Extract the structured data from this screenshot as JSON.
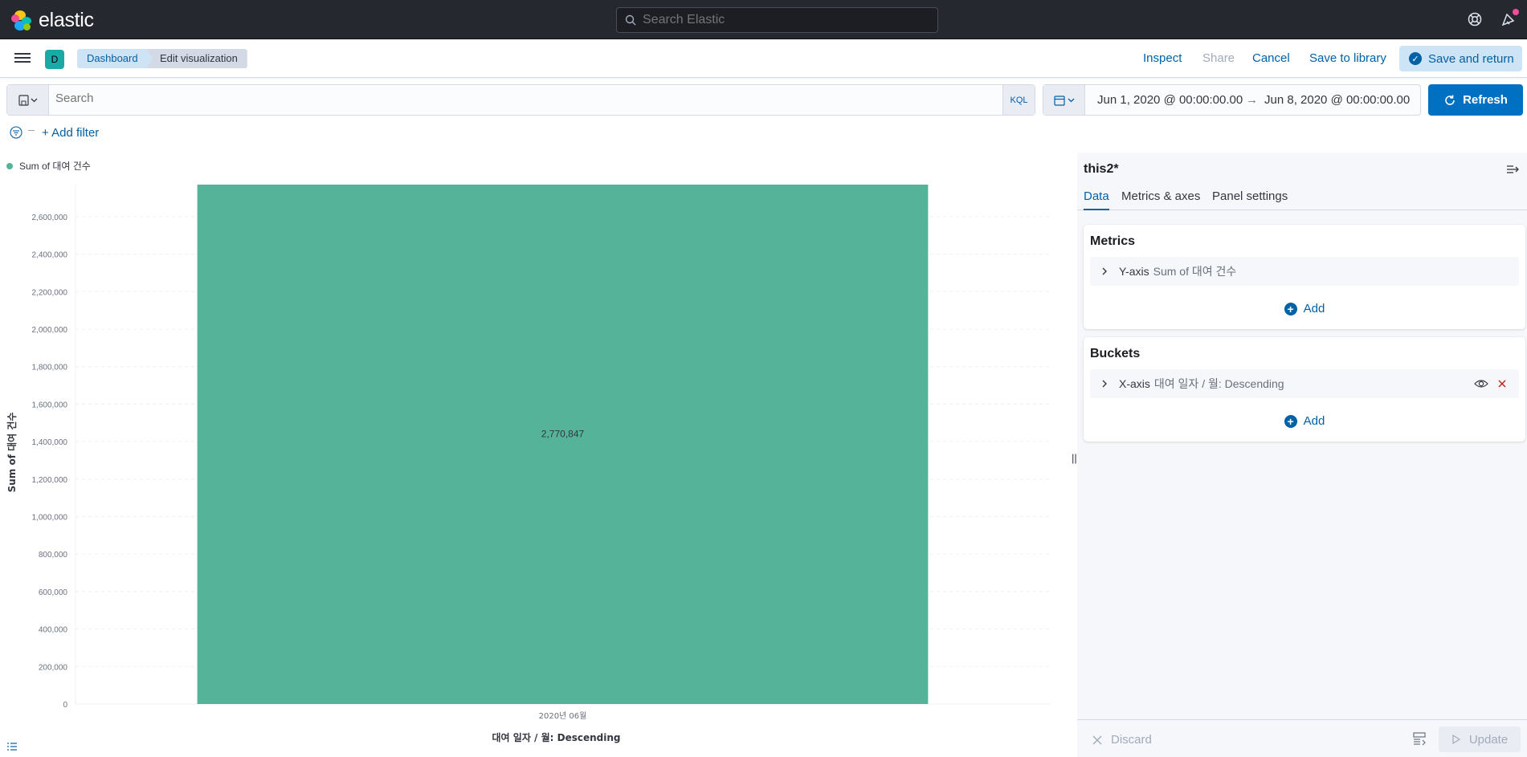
{
  "header": {
    "logo_text": "elastic",
    "search_placeholder": "Search Elastic",
    "help_icon": "help-icon",
    "newsfeed_icon": "newsfeed-icon"
  },
  "appbar": {
    "space_initial": "D",
    "breadcrumbs": [
      "Dashboard",
      "Edit visualization"
    ],
    "actions": {
      "inspect": "Inspect",
      "share": "Share",
      "cancel": "Cancel",
      "save_to_library": "Save to library",
      "save_and_return": "Save and return"
    }
  },
  "query": {
    "placeholder": "Search",
    "language": "KQL"
  },
  "date": {
    "start": "Jun 1, 2020 @ 00:00:00.00",
    "arrow": "→",
    "end": "Jun 8, 2020 @ 00:00:00.00",
    "refresh_label": "Refresh"
  },
  "filters": {
    "add_filter": "+ Add filter"
  },
  "chart_data": {
    "type": "bar",
    "categories": [
      "2020년 06월"
    ],
    "series": [
      {
        "name": "Sum of 대여 건수",
        "values": [
          2770847
        ]
      }
    ],
    "data_labels": [
      "2,770,847"
    ],
    "xlabel": "대여 일자 / 월: Descending",
    "ylabel": "Sum of 대여 건수",
    "ylim": [
      0,
      2770847
    ],
    "yticks": [
      0,
      200000,
      400000,
      600000,
      800000,
      1000000,
      1200000,
      1400000,
      1600000,
      1800000,
      2000000,
      2200000,
      2400000,
      2600000
    ],
    "ytick_labels": [
      "0",
      "200,000",
      "400,000",
      "600,000",
      "800,000",
      "1,000,000",
      "1,200,000",
      "1,400,000",
      "1,600,000",
      "1,800,000",
      "2,000,000",
      "2,200,000",
      "2,400,000",
      "2,600,000"
    ],
    "grid": true,
    "legend": "top-left",
    "color": "#54b399"
  },
  "sidebar": {
    "title": "this2*",
    "tabs": [
      "Data",
      "Metrics & axes",
      "Panel settings"
    ],
    "metrics": {
      "title": "Metrics",
      "item_label": "Y-axis",
      "item_desc": "Sum of 대여 건수",
      "add": "Add"
    },
    "buckets": {
      "title": "Buckets",
      "item_label": "X-axis",
      "item_desc": "대여 일자 / 월: Descending",
      "add": "Add"
    },
    "footer": {
      "discard": "Discard",
      "update": "Update"
    }
  },
  "colors": {
    "accent": "#0071c2",
    "header_bg": "#25282f",
    "bar": "#54b399",
    "danger": "#bd271e"
  }
}
